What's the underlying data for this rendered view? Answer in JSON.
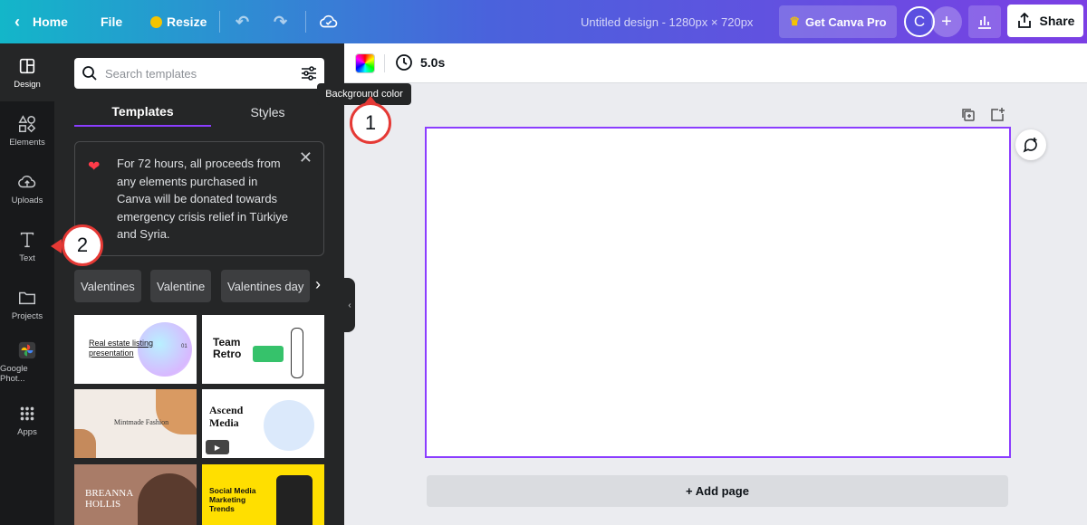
{
  "topbar": {
    "home_label": "Home",
    "file_label": "File",
    "resize_label": "Resize",
    "doc_title": "Untitled design - 1280px × 720px",
    "pro_label": "Get Canva Pro",
    "avatar_letter": "C",
    "share_label": "Share"
  },
  "rail": {
    "items": [
      {
        "label": "Design",
        "icon": "layout-icon"
      },
      {
        "label": "Elements",
        "icon": "shapes-icon"
      },
      {
        "label": "Uploads",
        "icon": "cloud-upload-icon"
      },
      {
        "label": "Text",
        "icon": "text-icon"
      },
      {
        "label": "Projects",
        "icon": "folder-icon"
      },
      {
        "label": "Google Phot...",
        "icon": "google-photos-icon"
      },
      {
        "label": "Apps",
        "icon": "apps-grid-icon"
      }
    ]
  },
  "panel": {
    "search_placeholder": "Search templates",
    "tabs": [
      "Templates",
      "Styles"
    ],
    "notice": "For 72 hours, all proceeds from any elements purchased in Canva will be donated towards emergency crisis relief in Türkiye and Syria.",
    "chips": [
      "Valentines",
      "Valentine",
      "Valentines day"
    ],
    "templates": [
      {
        "text": "Real estate listing presentation",
        "num": "01"
      },
      {
        "text": "Team Retro"
      },
      {
        "text": "Mintmade Fashion"
      },
      {
        "text": "Ascend Media"
      },
      {
        "text": "BREANNA HOLLIS"
      },
      {
        "text": "Social Media Marketing Trends"
      }
    ]
  },
  "context": {
    "duration": "5.0s",
    "tooltip": "Background color"
  },
  "annotations": {
    "badge1": "1",
    "badge2": "2"
  },
  "canvas": {
    "add_page_label": "+ Add page"
  },
  "colors": {
    "accent": "#8b3dff",
    "badge_border": "#e53935"
  }
}
